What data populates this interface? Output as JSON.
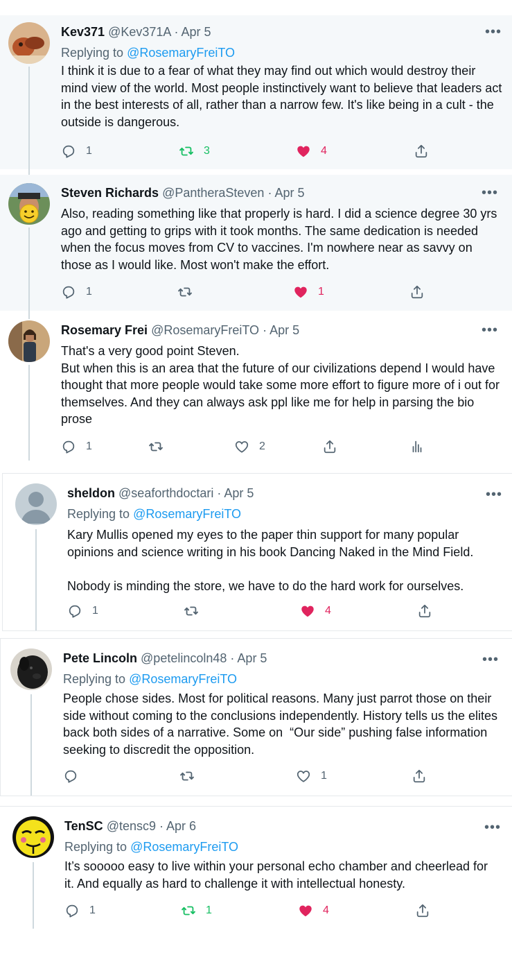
{
  "tweets": [
    {
      "name": "Kev371",
      "handle": "@Kev371A",
      "sep": "·",
      "date": "Apr 5",
      "replying_prefix": "Replying to",
      "replying_to": "@RosemaryFreiTO",
      "text": "I think it is due to a fear of what they may find out which would destroy their mind view of the world. Most people instinctively want to believe that leaders act in the best interests of all, rather than a narrow few. It's like being in a cult - the outside is dangerous.",
      "replies": "1",
      "retweets": "3",
      "likes": "4",
      "more": "•••"
    },
    {
      "name": "Steven Richards",
      "handle": "@PantheraSteven",
      "sep": "·",
      "date": "Apr 5",
      "text": "Also, reading something like that properly is hard. I did a science degree 30 yrs ago and getting to grips with it took months. The same dedication is needed when the focus moves from CV to vaccines. I'm nowhere near as savvy on those as I would like. Most won't make the effort.",
      "replies": "1",
      "retweets": "",
      "likes": "1",
      "more": "•••"
    },
    {
      "name": "Rosemary Frei",
      "handle": "@RosemaryFreiTO",
      "sep": "·",
      "date": "Apr 5",
      "text": "That's a very good point Steven.\nBut when this is an area that the future of our civilizations depend I would have thought that more people would take some more effort to figure more of i out for themselves. And they can always ask ppl like me for help in parsing the bio prose",
      "replies": "1",
      "retweets": "",
      "likes": "2",
      "more": "•••"
    },
    {
      "name": "sheldon",
      "handle": "@seaforthdoctari",
      "sep": "·",
      "date": "Apr 5",
      "replying_prefix": "Replying to",
      "replying_to": "@RosemaryFreiTO",
      "text": "Kary Mullis opened my eyes to the paper thin support for many popular opinions and science writing in his book Dancing Naked in the Mind Field.\n\nNobody is minding the store, we have to do the hard work for ourselves.",
      "replies": "1",
      "retweets": "",
      "likes": "4",
      "more": "•••"
    },
    {
      "name": "Pete Lincoln",
      "handle": "@petelincoln48",
      "sep": "·",
      "date": "Apr 5",
      "replying_prefix": "Replying to",
      "replying_to": "@RosemaryFreiTO",
      "text": "People chose sides. Most for political reasons. Many just parrot those on their side without coming to the conclusions independently. History tells us the elites back both sides of a narrative. Some on  “Our side” pushing false information seeking to discredit the opposition.",
      "replies": "",
      "retweets": "",
      "likes": "1",
      "more": "•••"
    },
    {
      "name": "TenSC",
      "handle": "@tensc9",
      "sep": "·",
      "date": "Apr 6",
      "replying_prefix": "Replying to",
      "replying_to": "@RosemaryFreiTO",
      "text": "It’s sooooo easy to live within your personal echo chamber and cheerlead for it. And equally as hard to challenge it with intellectual honesty.",
      "replies": "1",
      "retweets": "1",
      "likes": "4",
      "more": "•••"
    }
  ],
  "icons": {
    "reply": "reply-icon",
    "retweet": "retweet-icon",
    "like": "heart-icon",
    "share": "share-icon",
    "analytics": "analytics-icon",
    "more": "more-icon"
  },
  "colors": {
    "retweet_active": "#17bf63",
    "like_active": "#e0245e",
    "muted": "#536471",
    "link": "#1d9bf0",
    "thread_line": "#cfd9de",
    "bg_gray": "#f5f8fa"
  }
}
